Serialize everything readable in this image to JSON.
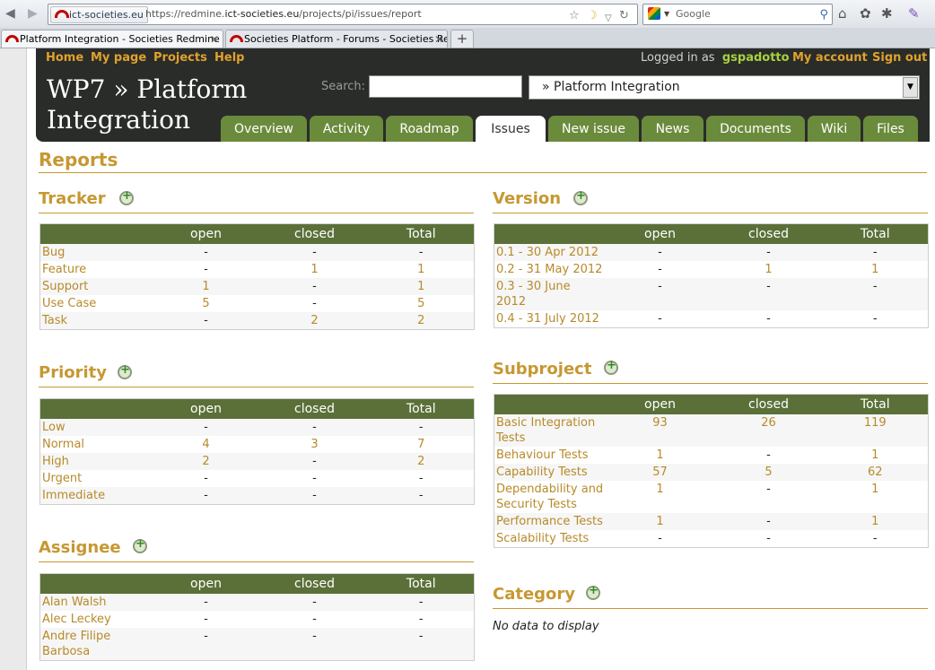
{
  "browser": {
    "site_identity": "ict-societies.eu",
    "url_prefix": "https://redmine.",
    "url_domain": "ict-societies.eu",
    "url_path": "/projects/pi/issues/report",
    "search_placeholder": "Google",
    "tabs": [
      {
        "label": "Platform Integration - Societies Redmine",
        "active": true
      },
      {
        "label": "Societies Platform - Forums - Societies Re...",
        "active": false
      }
    ],
    "new_tab_label": "+"
  },
  "top_menu": {
    "items": [
      "Home",
      "My page",
      "Projects",
      "Help"
    ],
    "logged_as_label": "Logged in as",
    "username": "gspadotto",
    "my_account": "My account",
    "sign_out": "Sign out"
  },
  "header": {
    "title_line1": "WP7 » Platform",
    "title_line2": "Integration",
    "search_label": "Search:",
    "project_jump": "» Platform Integration"
  },
  "project_tabs": [
    {
      "label": "Overview"
    },
    {
      "label": "Activity"
    },
    {
      "label": "Roadmap"
    },
    {
      "label": "Issues",
      "selected": true
    },
    {
      "label": "New issue"
    },
    {
      "label": "News"
    },
    {
      "label": "Documents"
    },
    {
      "label": "Wiki"
    },
    {
      "label": "Files"
    }
  ],
  "page_title": "Reports",
  "columns": {
    "open": "open",
    "closed": "closed",
    "total": "Total"
  },
  "tracker": {
    "title": "Tracker",
    "rows": [
      {
        "name": "Bug",
        "open": "-",
        "closed": "-",
        "total": "-"
      },
      {
        "name": "Feature",
        "open": "-",
        "closed": "1",
        "total": "1"
      },
      {
        "name": "Support",
        "open": "1",
        "closed": "-",
        "total": "1"
      },
      {
        "name": "Use Case",
        "open": "5",
        "closed": "-",
        "total": "5"
      },
      {
        "name": "Task",
        "open": "-",
        "closed": "2",
        "total": "2"
      }
    ]
  },
  "priority": {
    "title": "Priority",
    "rows": [
      {
        "name": "Low",
        "open": "-",
        "closed": "-",
        "total": "-"
      },
      {
        "name": "Normal",
        "open": "4",
        "closed": "3",
        "total": "7"
      },
      {
        "name": "High",
        "open": "2",
        "closed": "-",
        "total": "2"
      },
      {
        "name": "Urgent",
        "open": "-",
        "closed": "-",
        "total": "-"
      },
      {
        "name": "Immediate",
        "open": "-",
        "closed": "-",
        "total": "-"
      }
    ]
  },
  "assignee": {
    "title": "Assignee",
    "rows": [
      {
        "name": "Alan Walsh",
        "open": "-",
        "closed": "-",
        "total": "-"
      },
      {
        "name": "Alec Leckey",
        "open": "-",
        "closed": "-",
        "total": "-"
      },
      {
        "name": "Andre Filipe Barbosa",
        "open": "-",
        "closed": "-",
        "total": "-"
      }
    ]
  },
  "version": {
    "title": "Version",
    "rows": [
      {
        "name": "0.1 - 30 Apr 2012",
        "open": "-",
        "closed": "-",
        "total": "-"
      },
      {
        "name": "0.2 - 31 May 2012",
        "open": "-",
        "closed": "1",
        "total": "1"
      },
      {
        "name": "0.3 - 30 June 2012",
        "open": "-",
        "closed": "-",
        "total": "-"
      },
      {
        "name": "0.4 - 31 July 2012",
        "open": "-",
        "closed": "-",
        "total": "-"
      }
    ]
  },
  "subproject": {
    "title": "Subproject",
    "rows": [
      {
        "name": "Basic Integration Tests",
        "open": "93",
        "closed": "26",
        "total": "119"
      },
      {
        "name": "Behaviour Tests",
        "open": "1",
        "closed": "-",
        "total": "1"
      },
      {
        "name": "Capability Tests",
        "open": "57",
        "closed": "5",
        "total": "62"
      },
      {
        "name": "Dependability and Security Tests",
        "open": "1",
        "closed": "-",
        "total": "1"
      },
      {
        "name": "Performance Tests",
        "open": "1",
        "closed": "-",
        "total": "1"
      },
      {
        "name": "Scalability Tests",
        "open": "-",
        "closed": "-",
        "total": "-"
      }
    ]
  },
  "category": {
    "title": "Category",
    "no_data": "No data to display"
  }
}
